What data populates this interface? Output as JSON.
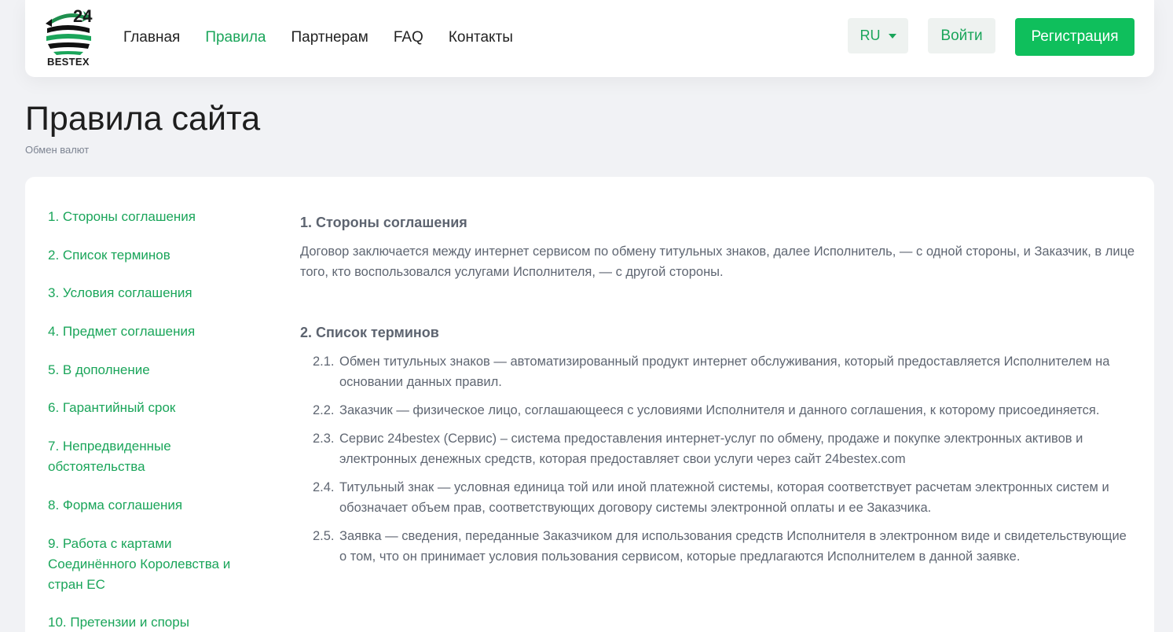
{
  "header": {
    "logo_number": "24",
    "logo_text": "BESTEX",
    "nav": [
      {
        "label": "Главная",
        "active": false
      },
      {
        "label": "Правила",
        "active": true
      },
      {
        "label": "Партнерам",
        "active": false
      },
      {
        "label": "FAQ",
        "active": false
      },
      {
        "label": "Контакты",
        "active": false
      }
    ],
    "language": "RU",
    "login_label": "Войти",
    "register_label": "Регистрация"
  },
  "page": {
    "title": "Правила сайта",
    "breadcrumb": "Обмен валют"
  },
  "toc": [
    "1. Стороны соглашения",
    "2. Список терминов",
    "3. Условия соглашения",
    "4. Предмет соглашения",
    "5. В дополнение",
    "6. Гарантийный срок",
    "7. Непредвиденные обстоятельства",
    "8. Форма соглашения",
    "9. Работа с картами Соединённого Королевства и стран ЕС",
    "10. Претензии и споры"
  ],
  "sections": {
    "s1_title": "1. Стороны соглашения",
    "s1_text": "Договор заключается между интернет сервисом по обмену титульных знаков, далее Исполнитель, — с одной стороны, и Заказчик, в лице того, кто воспользовался услугами Исполнителя, — с другой стороны.",
    "s2_title": "2. Список терминов",
    "terms": [
      {
        "num": "2.1.",
        "text": "Обмен титульных знаков — автоматизированный продукт интернет обслуживания, который предоставляется Исполнителем на основании данных правил."
      },
      {
        "num": "2.2.",
        "text": "Заказчик — физическое лицо, соглашающееся с условиями Исполнителя и данного соглашения, к которому присоединяется."
      },
      {
        "num": "2.3.",
        "text": "Сервис 24bestex (Сервис) – система предоставления интернет-услуг по обмену, продаже и покупке электронных активов и электронных денежных средств, которая предоставляет свои услуги через сайт 24bestex.com"
      },
      {
        "num": "2.4.",
        "text": "Титульный знак — условная единица той или иной платежной системы, которая соответствует расчетам электронных систем и обозначает объем прав, соответствующих договору системы электронной оплаты и ее Заказчика."
      },
      {
        "num": "2.5.",
        "text": "Заявка — сведения, переданные Заказчиком для использования средств Исполнителя в электронном виде и свидетельствующие о том, что он принимает условия пользования сервисом, которые предлагаются Исполнителем в данной заявке."
      }
    ]
  },
  "colors": {
    "accent": "#1aa55a",
    "button": "#0fbf5c",
    "background": "#f1f2f5"
  }
}
